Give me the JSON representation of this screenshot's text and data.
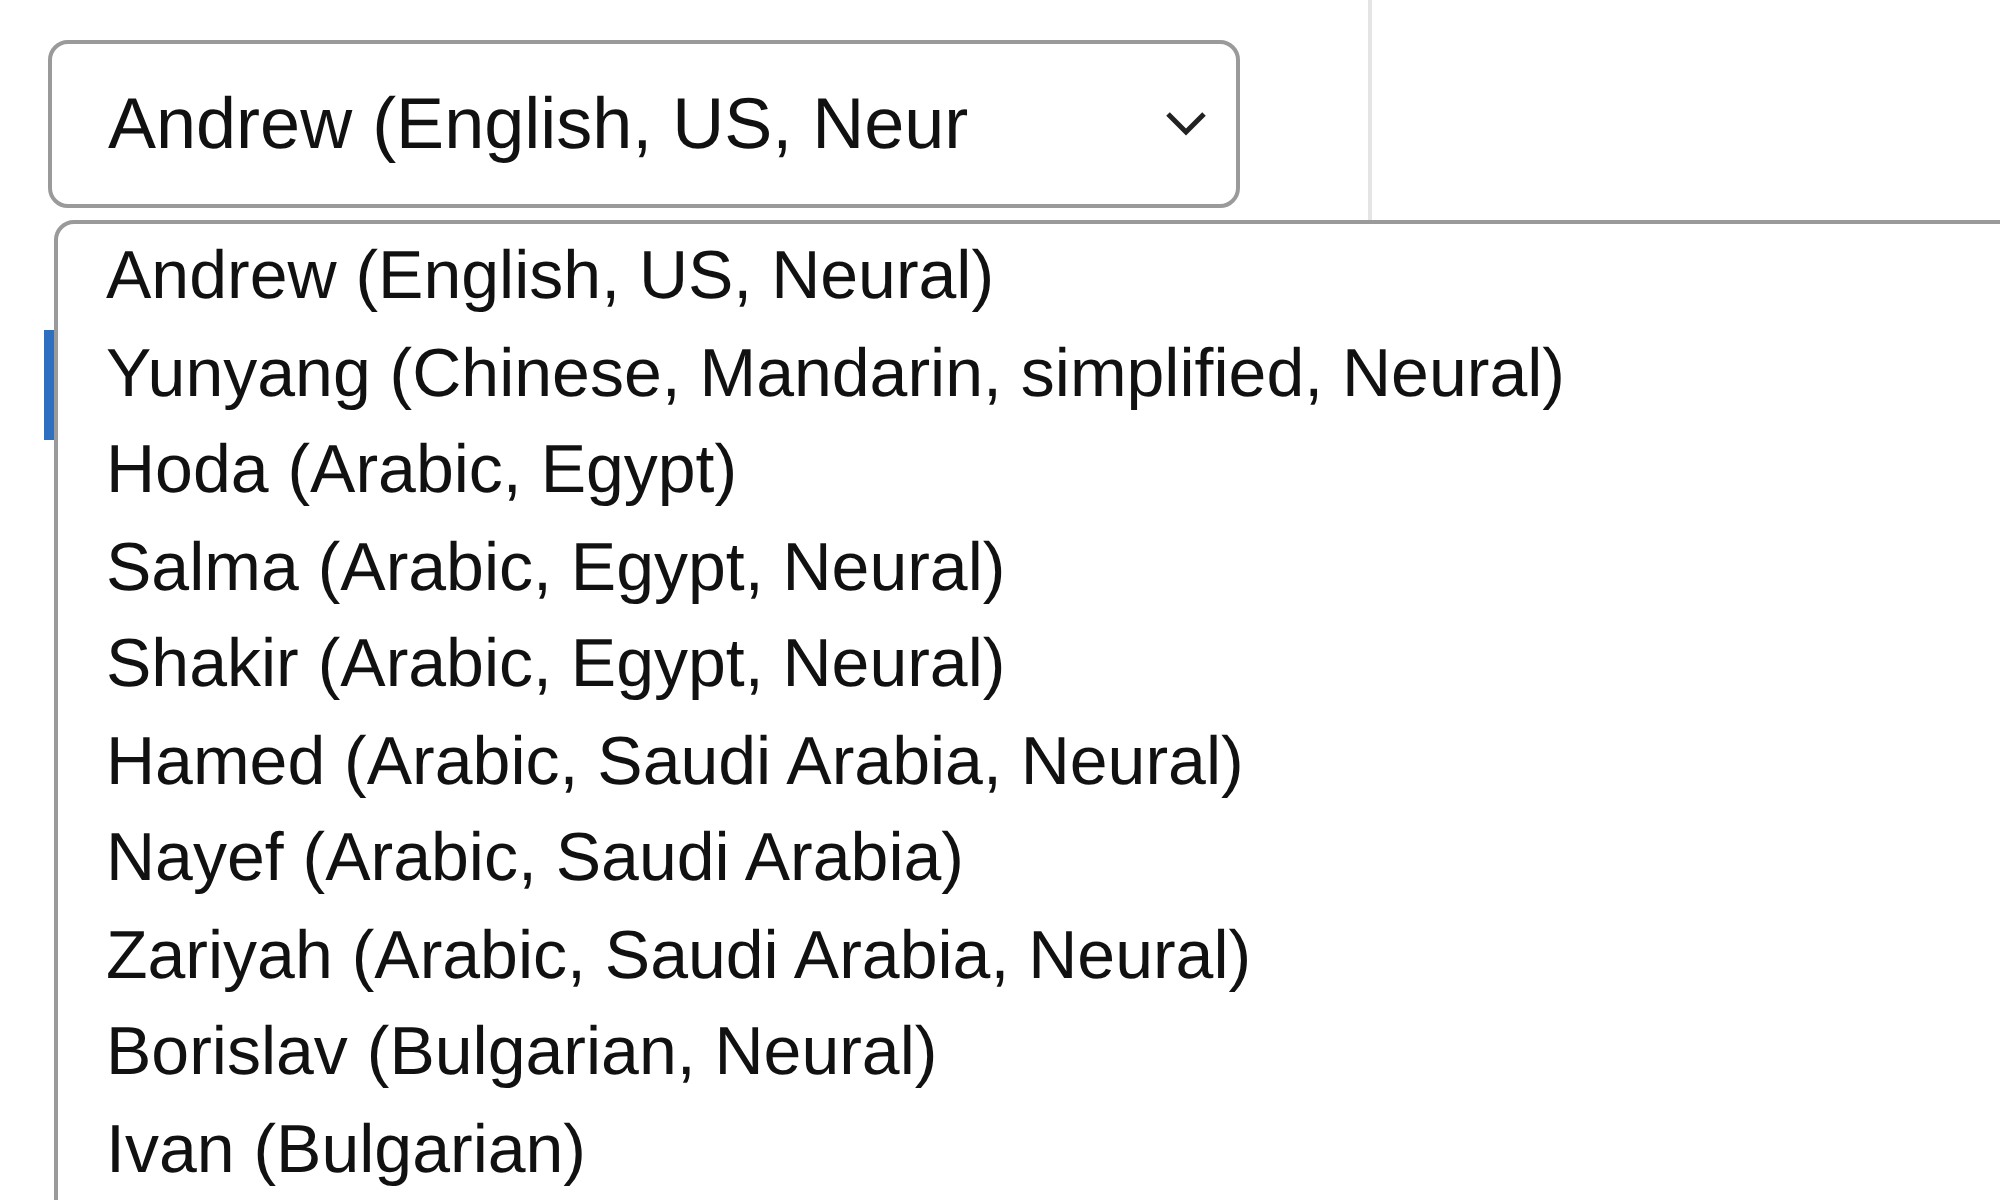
{
  "voice_select": {
    "value": "Andrew (English, US, Neur"
  },
  "voice_options": [
    {
      "label": "Andrew (English, US, Neural)"
    },
    {
      "label": "Yunyang (Chinese, Mandarin, simplified, Neural)"
    },
    {
      "label": "Hoda (Arabic, Egypt)"
    },
    {
      "label": "Salma (Arabic, Egypt, Neural)"
    },
    {
      "label": "Shakir (Arabic, Egypt, Neural)"
    },
    {
      "label": "Hamed (Arabic, Saudi Arabia, Neural)"
    },
    {
      "label": "Nayef (Arabic, Saudi Arabia)"
    },
    {
      "label": "Zariyah (Arabic, Saudi Arabia, Neural)"
    },
    {
      "label": "Borislav (Bulgarian, Neural)"
    },
    {
      "label": "Ivan (Bulgarian)"
    }
  ]
}
